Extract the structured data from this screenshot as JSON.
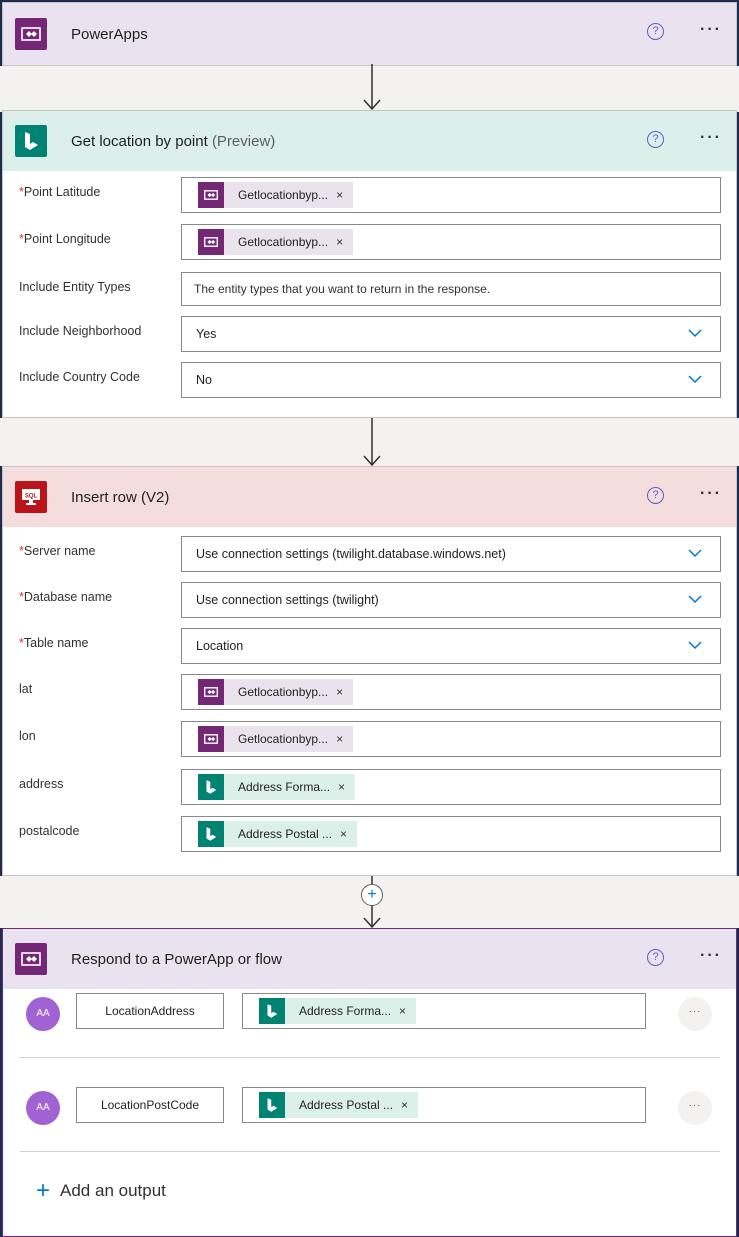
{
  "colors": {
    "powerapps": "#742774",
    "bing": "#008373",
    "sql": "#ba141a",
    "header_powerapps": "#ebe2ef",
    "header_bing": "#dcefea",
    "header_sql": "#f5dcdd",
    "help_accent": "#5b5fc7",
    "required": "#d13438",
    "add_accent": "#0078d4"
  },
  "icons": {
    "help": "question-circle-icon",
    "more": "ellipsis-icon",
    "dropdown": "chevron-down-icon",
    "arrow": "arrow-down-icon",
    "add": "plus-icon",
    "remove_token": "close-icon"
  },
  "powerapps_trigger": {
    "title": "PowerApps",
    "help": "?",
    "more": "···"
  },
  "bing_action": {
    "title": "Get location by point",
    "title_suffix": "(Preview)",
    "help": "?",
    "more": "···",
    "fields": {
      "point_latitude": {
        "required": "*",
        "label": "Point Latitude",
        "token": "Getlocationbyp...",
        "remove": "×"
      },
      "point_longitude": {
        "required": "*",
        "label": "Point Longitude",
        "token": "Getlocationbyp...",
        "remove": "×"
      },
      "include_entity_types": {
        "label": "Include Entity Types",
        "placeholder": "The entity types that you want to return in the response."
      },
      "include_neighborhood": {
        "label": "Include Neighborhood",
        "value": "Yes"
      },
      "include_country_code": {
        "label": "Include Country Code",
        "value": "No"
      }
    }
  },
  "sql_action": {
    "title": "Insert row (V2)",
    "help": "?",
    "more": "···",
    "fields": {
      "server_name": {
        "required": "*",
        "label": "Server name",
        "value": "Use connection settings (twilight.database.windows.net)"
      },
      "database_name": {
        "required": "*",
        "label": "Database name",
        "value": "Use connection settings (twilight)"
      },
      "table_name": {
        "required": "*",
        "label": "Table name",
        "value": "Location"
      },
      "lat": {
        "label": "lat",
        "token": "Getlocationbyp...",
        "remove": "×"
      },
      "lon": {
        "label": "lon",
        "token": "Getlocationbyp...",
        "remove": "×"
      },
      "address": {
        "label": "address",
        "token": "Address Forma...",
        "remove": "×"
      },
      "postalcode": {
        "label": "postalcode",
        "token": "Address Postal ...",
        "remove": "×"
      }
    }
  },
  "insert_step": {
    "label": "+"
  },
  "respond_action": {
    "title": "Respond to a PowerApp or flow",
    "help": "?",
    "more": "···",
    "outputs": [
      {
        "avatar": "AA",
        "name": "LocationAddress",
        "token": "Address Forma...",
        "remove": "×",
        "more": "···"
      },
      {
        "avatar": "AA",
        "name": "LocationPostCode",
        "token": "Address Postal ...",
        "remove": "×",
        "more": "···"
      }
    ],
    "add_output_icon": "+",
    "add_output_label": "Add an output"
  }
}
